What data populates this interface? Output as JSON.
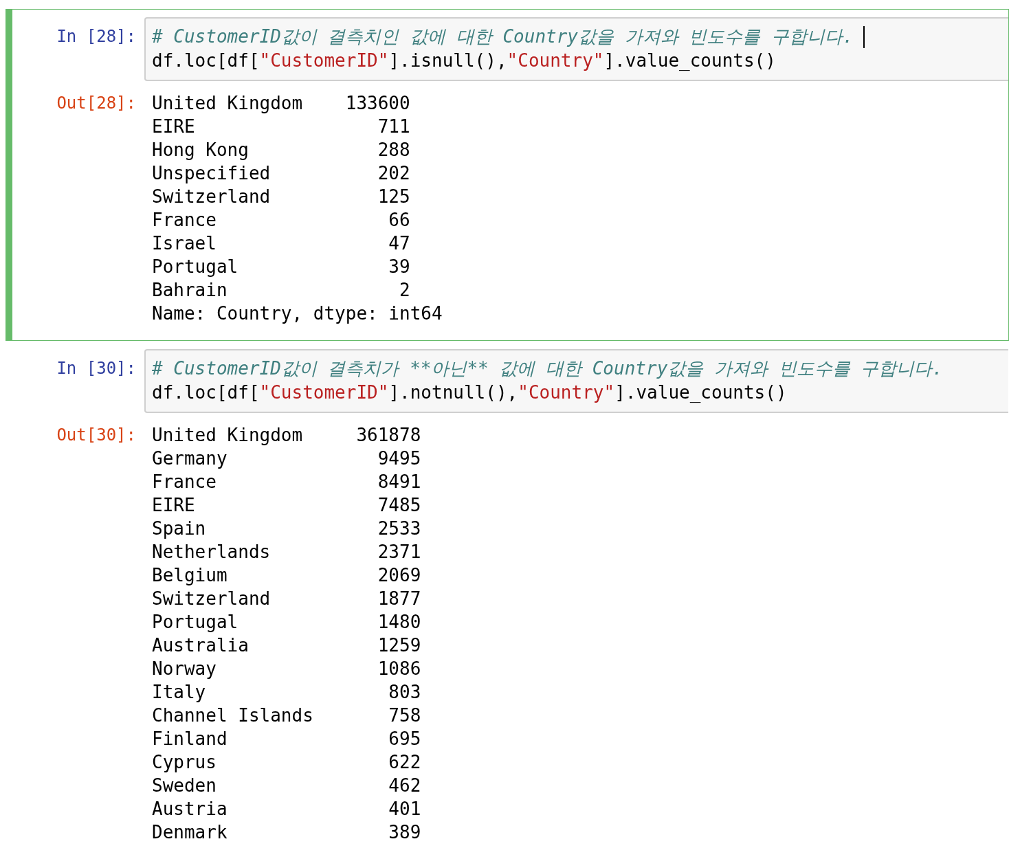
{
  "cells": [
    {
      "selected": true,
      "in_prompt": "In [28]:",
      "cursor": true,
      "code_lines": [
        [
          {
            "kind": "comment",
            "text": "# CustomerID값이 결측치인 값에 대한 Country값을 가져와 빈도수를 구합니다."
          }
        ],
        [
          {
            "kind": "plain",
            "text": "df.loc[df["
          },
          {
            "kind": "string",
            "text": "\"CustomerID\""
          },
          {
            "kind": "plain",
            "text": "].isnull(),"
          },
          {
            "kind": "string",
            "text": "\"Country\""
          },
          {
            "kind": "plain",
            "text": "].value_counts()"
          }
        ]
      ],
      "out_prompt": "Out[28]:",
      "output_rows": [
        {
          "label": "United Kingdom",
          "value": "133600"
        },
        {
          "label": "EIRE",
          "value": "711"
        },
        {
          "label": "Hong Kong",
          "value": "288"
        },
        {
          "label": "Unspecified",
          "value": "202"
        },
        {
          "label": "Switzerland",
          "value": "125"
        },
        {
          "label": "France",
          "value": "66"
        },
        {
          "label": "Israel",
          "value": "47"
        },
        {
          "label": "Portugal",
          "value": "39"
        },
        {
          "label": "Bahrain",
          "value": "2"
        }
      ],
      "output_footer": "Name: Country, dtype: int64"
    },
    {
      "selected": false,
      "in_prompt": "In [30]:",
      "cursor": false,
      "code_lines": [
        [
          {
            "kind": "comment",
            "text": "# CustomerID값이 결측치가 **아닌** 값에 대한 Country값을 가져와 빈도수를 구합니다."
          }
        ],
        [
          {
            "kind": "plain",
            "text": "df.loc[df["
          },
          {
            "kind": "string",
            "text": "\"CustomerID\""
          },
          {
            "kind": "plain",
            "text": "].notnull(),"
          },
          {
            "kind": "string",
            "text": "\"Country\""
          },
          {
            "kind": "plain",
            "text": "].value_counts()"
          }
        ]
      ],
      "out_prompt": "Out[30]:",
      "output_rows": [
        {
          "label": "United Kingdom",
          "value": "361878"
        },
        {
          "label": "Germany",
          "value": "9495"
        },
        {
          "label": "France",
          "value": "8491"
        },
        {
          "label": "EIRE",
          "value": "7485"
        },
        {
          "label": "Spain",
          "value": "2533"
        },
        {
          "label": "Netherlands",
          "value": "2371"
        },
        {
          "label": "Belgium",
          "value": "2069"
        },
        {
          "label": "Switzerland",
          "value": "1877"
        },
        {
          "label": "Portugal",
          "value": "1480"
        },
        {
          "label": "Australia",
          "value": "1259"
        },
        {
          "label": "Norway",
          "value": "1086"
        },
        {
          "label": "Italy",
          "value": "803"
        },
        {
          "label": "Channel Islands",
          "value": "758"
        },
        {
          "label": "Finland",
          "value": "695"
        },
        {
          "label": "Cyprus",
          "value": "622"
        },
        {
          "label": "Sweden",
          "value": "462"
        },
        {
          "label": "Austria",
          "value": "401"
        },
        {
          "label": "Denmark",
          "value": "389"
        }
      ]
    }
  ]
}
